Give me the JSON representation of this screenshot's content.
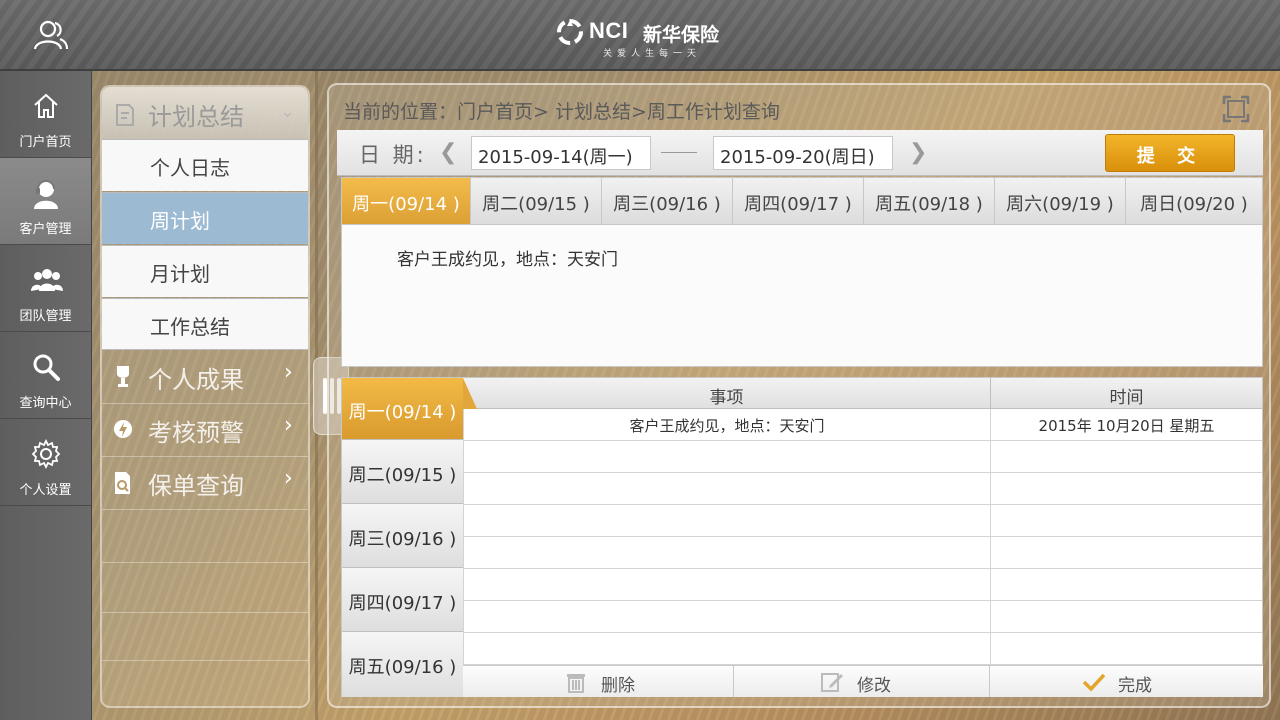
{
  "header": {
    "logo_en": "NCI",
    "logo_cn": "新华保险",
    "slogan": "关爱人生每一天"
  },
  "nav": [
    {
      "label": "门户首页",
      "icon": "home-icon"
    },
    {
      "label": "客户管理",
      "icon": "customer-icon",
      "active": true
    },
    {
      "label": "团队管理",
      "icon": "team-icon"
    },
    {
      "label": "查询中心",
      "icon": "search-icon"
    },
    {
      "label": "个人设置",
      "icon": "gear-icon"
    }
  ],
  "submenu": {
    "header": "计划总结",
    "items": [
      "个人日志",
      "周计划",
      "月计划",
      "工作总结"
    ],
    "active_item": "周计划",
    "categories": [
      "个人成果",
      "考核预警",
      "保单查询"
    ]
  },
  "breadcrumb": "当前的位置：门户首页> 计划总结>周工作计划查询",
  "date_filter": {
    "label": "日 期:",
    "start": "2015-09-14(周一)",
    "end": "2015-09-20(周日)",
    "submit_label": "提 交"
  },
  "day_tabs": [
    "周一(09/14 )",
    "周二(09/15 )",
    "周三(09/16 )",
    "周四(09/17 )",
    "周五(09/18 )",
    "周六(09/19 )",
    "周日(09/20 )"
  ],
  "active_day": "周一(09/14 )",
  "note_text": "客户王成约见，地点：天安门",
  "table": {
    "col_item": "事项",
    "col_time": "时间",
    "rows": [
      {
        "day": "周一(09/14 )",
        "item": "客户王成约见，地点：天安门",
        "time": "2015年 10月20日 星期五"
      },
      {
        "day": "周二(09/15 )",
        "item": "",
        "time": ""
      },
      {
        "day": "周三(09/16 )",
        "item": "",
        "time": ""
      },
      {
        "day": "周四(09/17 )",
        "item": "",
        "time": ""
      },
      {
        "day": "周五(09/16 )",
        "item": "",
        "time": ""
      }
    ]
  },
  "actions": {
    "delete": "删除",
    "edit": "修改",
    "done": "完成"
  },
  "colors": {
    "accent": "#E0A033",
    "selected_menu": "#9CBAD2",
    "topbar": "#616161"
  }
}
